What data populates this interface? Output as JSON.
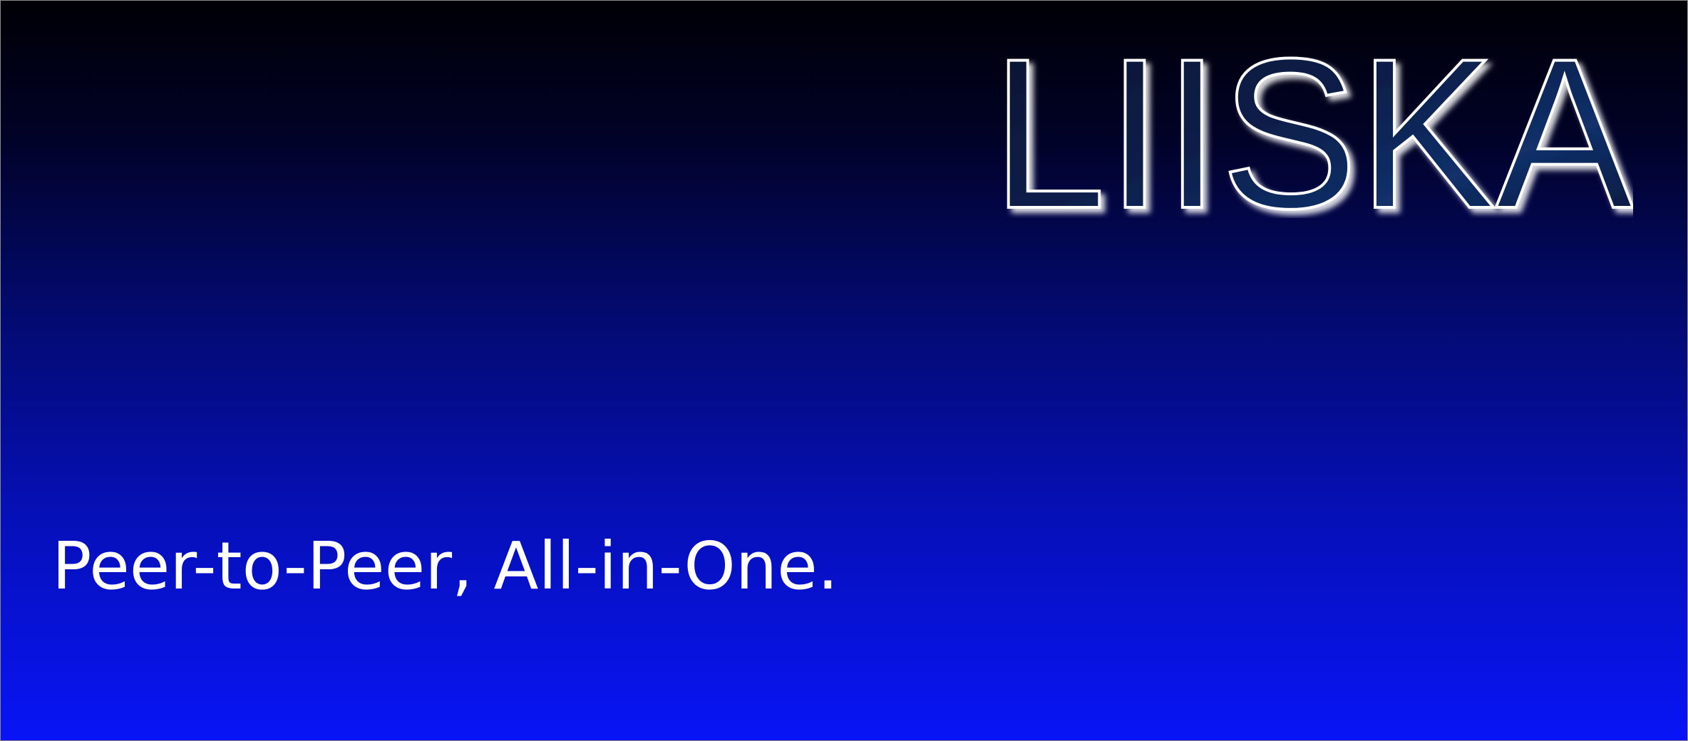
{
  "banner": {
    "logo_text": "LIISKA",
    "tagline": "Peer-to-Peer, All-in-One."
  },
  "colors": {
    "gradient_top": "#000005",
    "gradient_bottom": "#0814f6",
    "logo_outline": "#ffffff",
    "tagline": "#ffffff"
  }
}
